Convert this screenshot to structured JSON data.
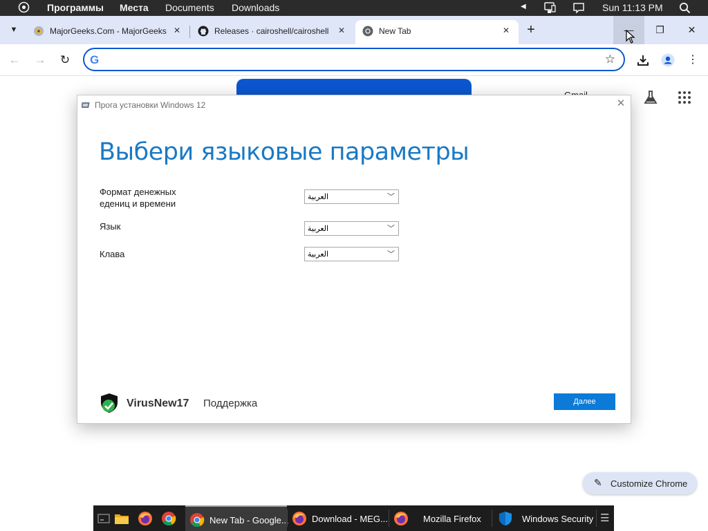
{
  "top_panel": {
    "menu_programs": "Программы",
    "menu_places": "Места",
    "menu_documents": "Documents",
    "menu_downloads": "Downloads",
    "clock": "Sun 11:13 PM"
  },
  "tabs": [
    {
      "title": "MajorGeeks.Com - MajorGeeks",
      "icon": "majorgeeks-icon"
    },
    {
      "title": "Releases · cairoshell/cairoshell",
      "icon": "github-icon"
    },
    {
      "title": "New Tab",
      "icon": "chrome-icon",
      "active": true
    }
  ],
  "toolbar": {
    "omnibox_value": "",
    "omnibox_placeholder": ""
  },
  "ntp": {
    "gmail_label": "Gmail",
    "customize_chrome": "Customize Chrome"
  },
  "setup": {
    "window_title": "Прога установки Windows 12",
    "heading": "Выбери языковые параметры",
    "fields": [
      {
        "label": "Формат денежных едениц и времени",
        "value": "العربية"
      },
      {
        "label": "Язык",
        "value": "العربية"
      },
      {
        "label": "Клава",
        "value": "العربية"
      }
    ],
    "brand": "VirusNew17",
    "support": "Поддержка",
    "next": "Далее"
  },
  "taskbar": {
    "tasks": [
      {
        "label": "New Tab - Google...",
        "icon": "chrome-icon"
      },
      {
        "label": "Download - MEG...",
        "icon": "firefox-icon"
      },
      {
        "label": "Mozilla Firefox",
        "icon": "firefox-icon"
      },
      {
        "label": "Windows Security",
        "icon": "shield-icon"
      }
    ]
  },
  "colors": {
    "accent": "#0b57d0",
    "setup_blue": "#1a79c4",
    "next_button": "#0c7ad7",
    "taskbar": "#1d1d1d"
  }
}
